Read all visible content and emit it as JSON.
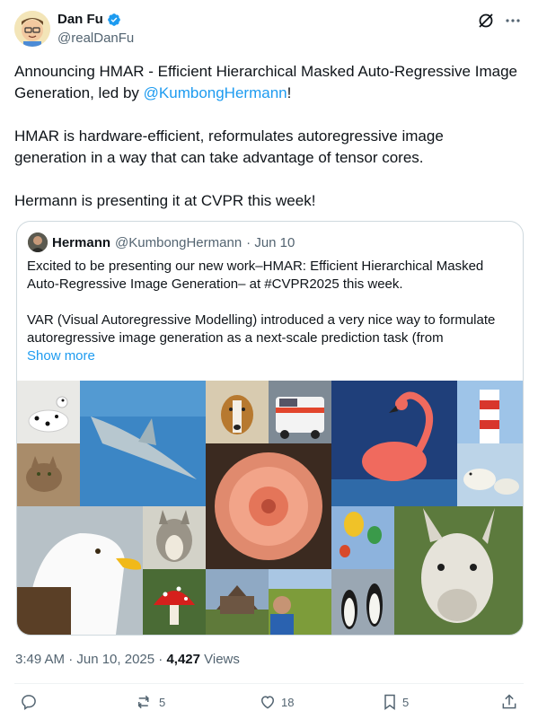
{
  "author": {
    "name": "Dan Fu",
    "handle": "@realDanFu"
  },
  "post": {
    "p1_prefix": "Announcing HMAR - Efficient Hierarchical Masked Auto-Regressive Image Generation, led by ",
    "p1_mention": "@KumbongHermann",
    "p1_suffix": "!",
    "p2": "HMAR is hardware-efficient, reformulates autoregressive image generation in a way that can take advantage of tensor cores.",
    "p3": "Hermann is presenting it at CVPR this week!"
  },
  "quoted": {
    "name": "Hermann",
    "handle": "@KumbongHermann",
    "date": "· Jun 10",
    "p1": "Excited to be presenting our new work–HMAR: Efficient Hierarchical Masked Auto-Regressive Image Generation– at #CVPR2025 this week.",
    "p2": "VAR (Visual Autoregressive Modelling) introduced a very nice way to formulate autoregressive image generation as a next-scale prediction task (from",
    "show_more": "Show more"
  },
  "meta": {
    "time": "3:49 AM · Jun 10, 2025 · ",
    "views_count": "4,427",
    "views_label": " Views"
  },
  "actions": {
    "reposts": "5",
    "likes": "18",
    "bookmarks": "5"
  },
  "colors": {
    "accent": "#1d9bf0",
    "secondary_text": "#536471",
    "border": "#cfd9de"
  },
  "icons": [
    "verified-badge-icon",
    "grok-icon",
    "more-options-icon",
    "reply-icon",
    "repost-icon",
    "like-icon",
    "bookmark-icon",
    "share-icon"
  ]
}
